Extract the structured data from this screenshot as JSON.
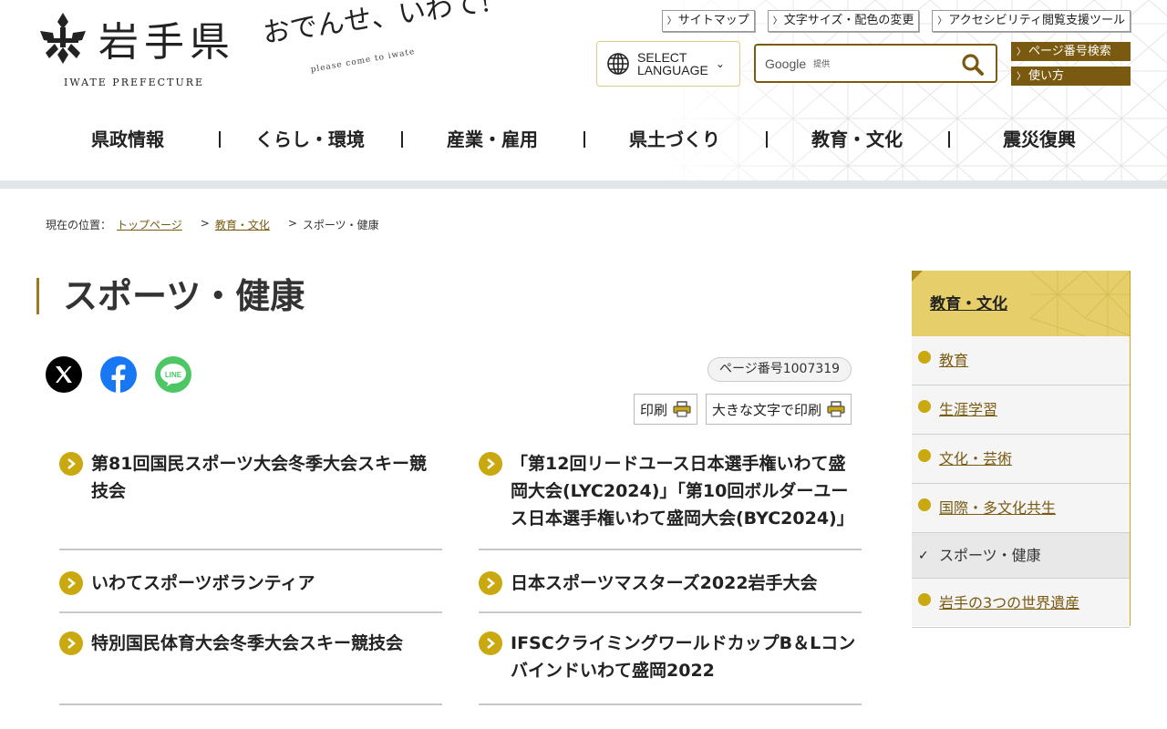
{
  "header": {
    "logo_text": "岩手県",
    "logo_en": "IWATE PREFECTURE",
    "catchphrase": "おでんせ、いわて!",
    "catch_sub": "please come to iwate",
    "util_links": [
      "サイトマップ",
      "文字サイズ・配色の変更",
      "アクセシビリティ閲覧支援ツール"
    ],
    "language_label_1": "SELECT",
    "language_label_2": "LANGUAGE",
    "search": {
      "google": "Google",
      "provided": "提供"
    },
    "page_search_label": "ページ番号検索",
    "howto_label": "使い方"
  },
  "gnav": [
    "県政情報",
    "くらし・環境",
    "産業・雇用",
    "県土づくり",
    "教育・文化",
    "震災復興"
  ],
  "breadcrumb": {
    "prefix": "現在の位置：",
    "items": [
      "トップページ",
      "教育・文化"
    ],
    "current": "スポーツ・健康"
  },
  "page": {
    "title": "スポーツ・健康",
    "page_number": "ページ番号1007319",
    "print": "印刷",
    "print_large": "大きな文字で印刷"
  },
  "sns": [
    "x-icon",
    "facebook-icon",
    "line-icon"
  ],
  "sns_line_text": "LINE",
  "articles": [
    "第81回国民スポーツ大会冬季大会スキー競技会",
    "「第12回リードユース日本選手権いわて盛岡大会(LYC2024)」「第10回ボルダーユース日本選手権いわて盛岡大会(BYC2024)」",
    "いわてスポーツボランティア",
    "日本スポーツマスターズ2022岩手大会",
    "特別国民体育大会冬季大会スキー競技会",
    "IFSCクライミングワールドカップB＆Lコンバインドいわて盛岡2022"
  ],
  "sidebar": {
    "heading": "教育・文化",
    "items": [
      "教育",
      "生涯学習",
      "文化・芸術",
      "国際・多文化共生",
      "スポーツ・健康",
      "岩手の3つの世界遺産"
    ],
    "current_index": 4
  },
  "colors": {
    "gold": "#c9a90f",
    "brown": "#7a5a10",
    "header_band": "#e2e6e8"
  }
}
